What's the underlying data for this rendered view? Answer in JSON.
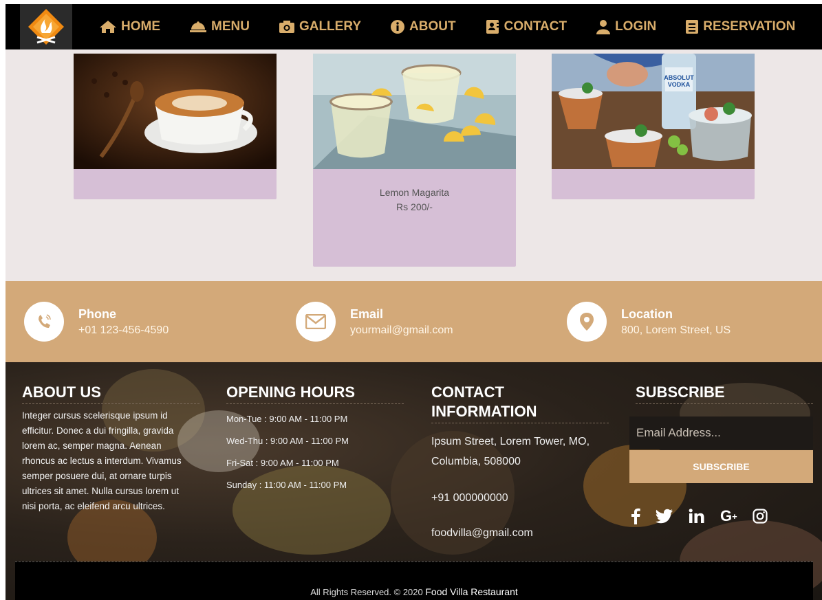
{
  "nav": {
    "items": [
      {
        "label": "HOME",
        "icon": "home-icon"
      },
      {
        "label": "MENU",
        "icon": "cloche-icon"
      },
      {
        "label": "GALLERY",
        "icon": "camera-icon"
      },
      {
        "label": "ABOUT",
        "icon": "info-icon"
      },
      {
        "label": "CONTACT",
        "icon": "contact-card-icon"
      },
      {
        "label": "LOGIN",
        "icon": "user-icon"
      },
      {
        "label": "RESERVATION",
        "icon": "book-icon"
      }
    ]
  },
  "cards": [
    {
      "name": "",
      "price": "",
      "image": "coffee-cup-image"
    },
    {
      "name": "Lemon Magarita",
      "price": "Rs 200/-",
      "image": "lemon-drink-image"
    },
    {
      "name": "",
      "price": "",
      "image": "vodka-mule-image"
    }
  ],
  "contact_strip": {
    "phone": {
      "title": "Phone",
      "value": "+01 123-456-4590"
    },
    "email": {
      "title": "Email",
      "value": "yourmail@gmail.com"
    },
    "location": {
      "title": "Location",
      "value": "800, Lorem Street, US"
    }
  },
  "footer": {
    "about": {
      "title": "ABOUT US",
      "text": "Integer cursus scelerisque ipsum id efficitur. Donec a dui fringilla, gravida lorem ac, semper magna. Aenean rhoncus ac lectus a interdum. Vivamus semper posuere dui, at ornare turpis ultrices sit amet. Nulla cursus lorem ut nisi porta, ac eleifend arcu ultrices."
    },
    "hours": {
      "title": "OPENING HOURS",
      "lines": [
        "Mon-Tue : 9:00 AM - 11:00 PM",
        "Wed-Thu : 9:00 AM - 11:00 PM",
        "Fri-Sat : 9:00 AM - 11:00 PM",
        "Sunday : 11:00 AM - 11:00 PM"
      ]
    },
    "contact": {
      "title": "CONTACT INFORMATION",
      "address": "Ipsum Street, Lorem Tower, MO, Columbia, 508000",
      "phone": "+91 000000000",
      "email": "foodvilla@gmail.com"
    },
    "subscribe": {
      "title": "SUBSCRIBE",
      "placeholder": "Email Address...",
      "button": "SUBSCRIBE"
    },
    "social": [
      "facebook-icon",
      "twitter-icon",
      "linkedin-icon",
      "google-plus-icon",
      "instagram-icon"
    ],
    "copyright": "All Rights Reserved. © 2020",
    "brand": "Food Villa Restaurant"
  },
  "colors": {
    "accent": "#d3a979",
    "card": "#d6bfd6",
    "bg": "#ede7e7"
  }
}
